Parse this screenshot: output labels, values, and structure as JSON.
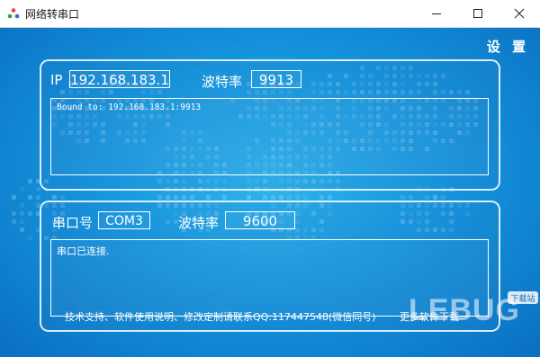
{
  "window": {
    "title": "网络转串口"
  },
  "header": {
    "settings_label": "设 置"
  },
  "network": {
    "ip_label": "IP",
    "ip_value": "192.168.183.1",
    "baud_label": "波特率",
    "baud_value": "9913",
    "log_text": "Bound to: 192.168.183.1:9913"
  },
  "serial": {
    "port_label": "串口号",
    "port_value": "COM3",
    "baud_label": "波特率",
    "baud_value": "9600",
    "log_text": "串口已连接."
  },
  "footer": {
    "support_text": "技术支持、软件使用说明、修改定制请联系QQ:117447548(微信同号)",
    "more_link": "更多软件下载"
  },
  "watermark": {
    "text": "LEBUG",
    "sub": "下载站"
  },
  "colors": {
    "bg_center": "#2fb6ee",
    "bg_edge": "#0a6fc0",
    "text": "#ffffff"
  },
  "icons": [
    "app-icon",
    "minimize-icon",
    "maximize-icon",
    "close-icon"
  ]
}
